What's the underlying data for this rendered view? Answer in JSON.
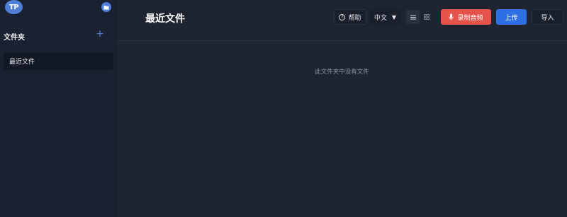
{
  "sidebar": {
    "logo_text": "TP",
    "folder_icon": "folder-icon",
    "section_title": "文件夹",
    "add_label": "+",
    "items": [
      {
        "label": "最近文件",
        "active": true
      }
    ]
  },
  "header": {
    "title": "最近文件",
    "help_label": "帮助",
    "language": {
      "selected": "中文"
    },
    "view_modes": [
      "list",
      "grid"
    ],
    "active_view": "list",
    "record_label": "录制音频",
    "upload_label": "上传",
    "import_label": "导入"
  },
  "main": {
    "empty_message": "此文件夹中没有文件"
  },
  "colors": {
    "accent": "#2f6fe4",
    "record": "#e5534b",
    "background": "#1e2430",
    "sidebar": "#1a2232"
  }
}
